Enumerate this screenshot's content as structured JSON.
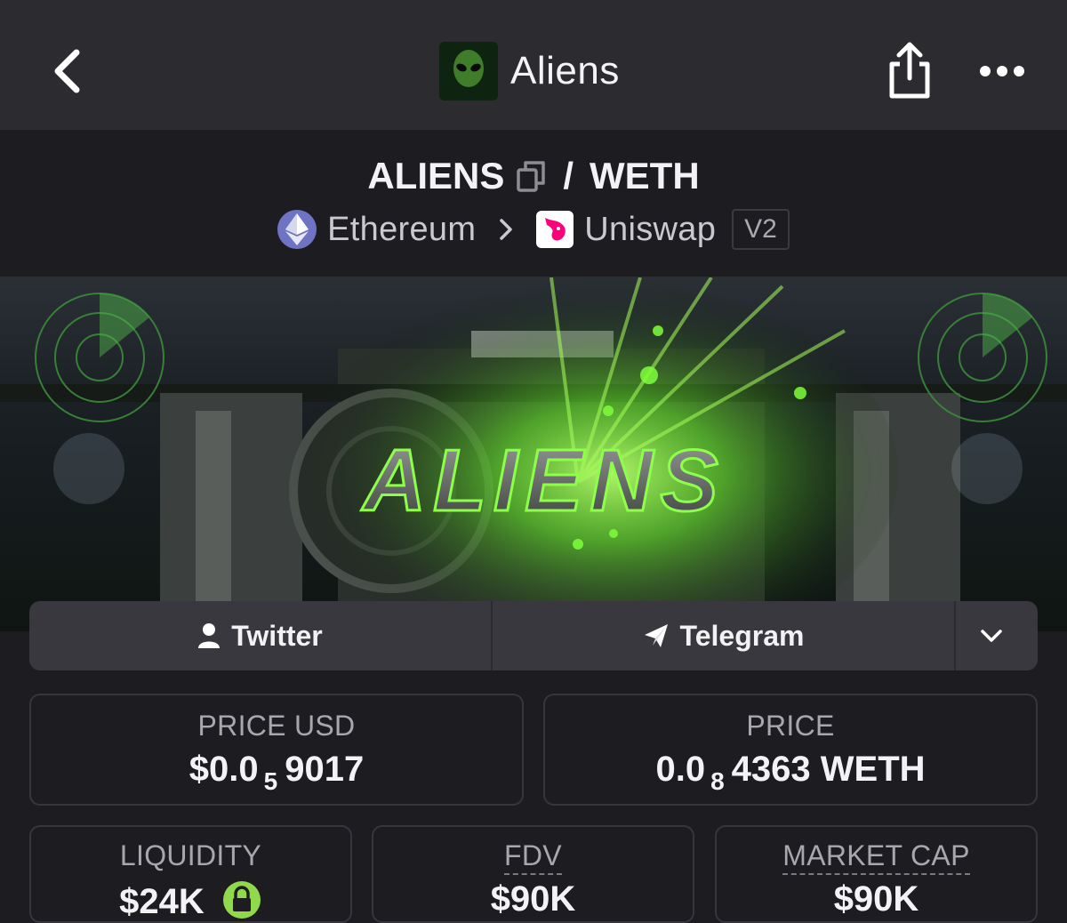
{
  "nav": {
    "title": "Aliens",
    "icons": {
      "back": "chevron-left-icon",
      "share": "share-icon",
      "more": "more-horizontal-icon"
    },
    "app_icon_text": "ALIENS"
  },
  "pair": {
    "base": "ALIENS",
    "separator": "/",
    "quote": "WETH",
    "chain": "Ethereum",
    "dex": "Uniswap",
    "version": "V2"
  },
  "banner": {
    "title": "ALIENS"
  },
  "links": {
    "twitter": "Twitter",
    "telegram": "Telegram"
  },
  "stats": {
    "price_usd": {
      "label": "PRICE USD",
      "prefix": "$0.0",
      "zeros": "5",
      "digits": "9017"
    },
    "price_weth": {
      "label": "PRICE",
      "prefix": "0.0",
      "zeros": "8",
      "digits": "4363 WETH"
    },
    "liquidity": {
      "label": "LIQUIDITY",
      "value": "$24K"
    },
    "fdv": {
      "label": "FDV",
      "value": "$90K"
    },
    "market_cap": {
      "label": "MARKET CAP",
      "value": "$90K"
    }
  },
  "colors": {
    "background": "#1c1c21",
    "nav_bg": "#2b2b30",
    "accent_green": "#7dff3a",
    "ethereum": "#6e74c3",
    "uniswap_pink": "#ff007a"
  }
}
